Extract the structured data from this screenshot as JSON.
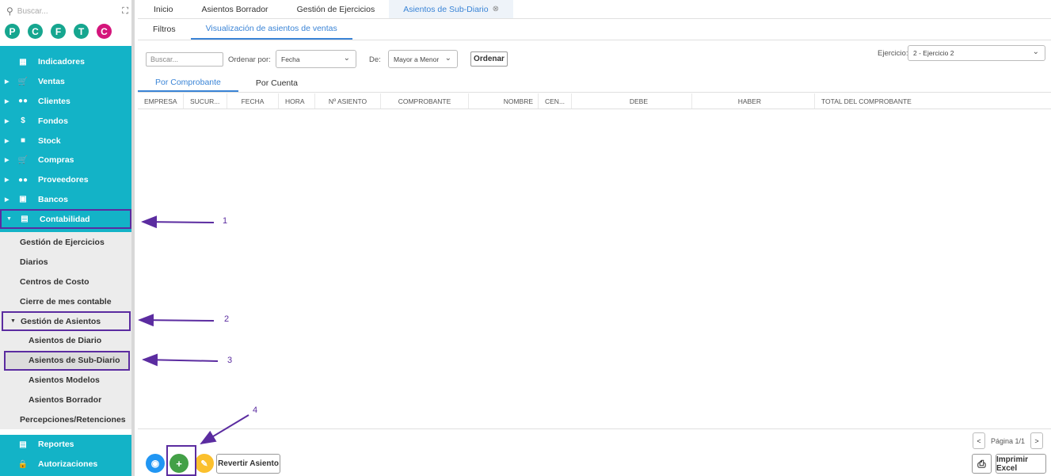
{
  "colors": {
    "teal": "#13b3c7",
    "accent": "#3a84d6",
    "annotation": "#5b2ca0"
  },
  "sidebar": {
    "search_placeholder": "Buscar...",
    "avatars": [
      {
        "letter": "P",
        "color": "#16a68f"
      },
      {
        "letter": "C",
        "color": "#16a68f"
      },
      {
        "letter": "F",
        "color": "#16a68f"
      },
      {
        "letter": "T",
        "color": "#16a68f"
      },
      {
        "letter": "C",
        "color": "#d4157b"
      }
    ],
    "items": [
      {
        "label": "Indicadores",
        "icon": "dashboard-icon"
      },
      {
        "label": "Ventas",
        "icon": "cart-icon"
      },
      {
        "label": "Clientes",
        "icon": "people-icon"
      },
      {
        "label": "Fondos",
        "icon": "dollar-icon"
      },
      {
        "label": "Stock",
        "icon": "box-icon"
      },
      {
        "label": "Compras",
        "icon": "basket-icon"
      },
      {
        "label": "Proveedores",
        "icon": "people-icon"
      },
      {
        "label": "Bancos",
        "icon": "briefcase-icon"
      },
      {
        "label": "Contabilidad",
        "icon": "book-icon"
      }
    ],
    "contabilidad_sub": [
      "Gestión de Ejercicios",
      "Diarios",
      "Centros de Costo",
      "Cierre de mes contable",
      "Gestión de Asientos",
      "Asientos de Diario",
      "Asientos de Sub-Diario",
      "Asientos Modelos",
      "Asientos Borrador",
      "Percepciones/Retenciones"
    ],
    "bottom_items": [
      {
        "label": "Reportes",
        "icon": "report-icon"
      },
      {
        "label": "Autorizaciones",
        "icon": "lock-icon"
      }
    ]
  },
  "tabs": [
    "Inicio",
    "Asientos Borrador",
    "Gestión de Ejercicios",
    "Asientos de Sub-Diario"
  ],
  "subtabs": [
    "Filtros",
    "Visualización de asientos de ventas"
  ],
  "filters": {
    "search_placeholder": "Buscar...",
    "order_by_label": "Ordenar por:",
    "order_by_value": "Fecha",
    "direction_label": "De:",
    "direction_value": "Mayor a Menor",
    "order_button": "Ordenar",
    "ejercicio_label": "Ejercicio:",
    "ejercicio_value": "2 - Ejercicio 2"
  },
  "view_tabs": [
    "Por Comprobante",
    "Por Cuenta"
  ],
  "columns": [
    "EMPRESA",
    "SUCUR...",
    "FECHA",
    "HORA",
    "Nº ASIENTO",
    "COMPROBANTE",
    "NOMBRE",
    "CEN...",
    "DEBE",
    "HABER",
    "TOTAL DEL COMPROBANTE"
  ],
  "footer": {
    "revertir": "Revertir Asiento",
    "pagina": "Página 1/1",
    "imprimir": "Imprimir Excel"
  },
  "annotations": [
    "1",
    "2",
    "3",
    "4"
  ]
}
